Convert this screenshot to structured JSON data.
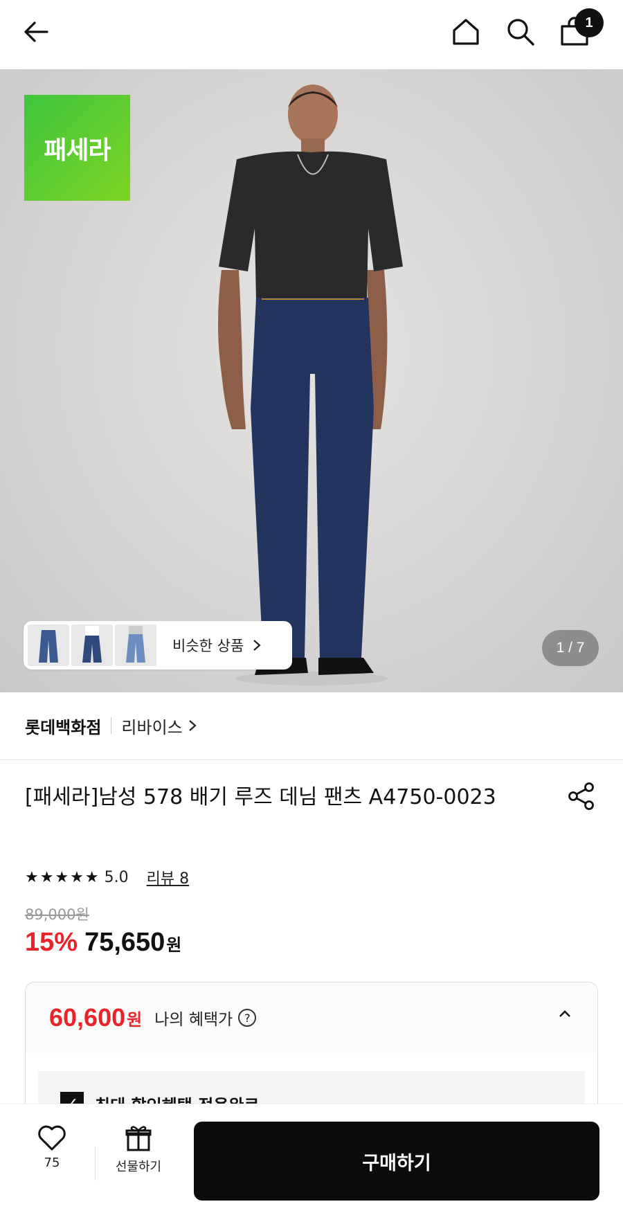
{
  "header": {
    "cart_count": "1"
  },
  "hero": {
    "brand_logo_text": "패세라",
    "similar_label": "비슷한 상품",
    "page_indicator": "1 / 7"
  },
  "store": {
    "name": "롯데백화점",
    "brand": "리바이스"
  },
  "product": {
    "title": "[패세라]남성 578 배기 루즈 데님 팬츠 A4750-0023",
    "stars": "★★★★★",
    "rating": "5.0",
    "review_label": "리뷰 8",
    "original_price": "89,000원",
    "discount": "15%",
    "sale_price": "75,650",
    "currency": "원"
  },
  "benefit": {
    "price": "60,600",
    "currency": "원",
    "label": "나의 혜택가",
    "help": "?",
    "body_text": "최대 할인혜택 적용완료"
  },
  "bottom": {
    "wish_count": "75",
    "gift_label": "선물하기",
    "buy_label": "구매하기"
  },
  "colors": {
    "accent_red": "#e8242a",
    "brand_green": "#3ec63e",
    "button_black": "#0c0c0c"
  }
}
